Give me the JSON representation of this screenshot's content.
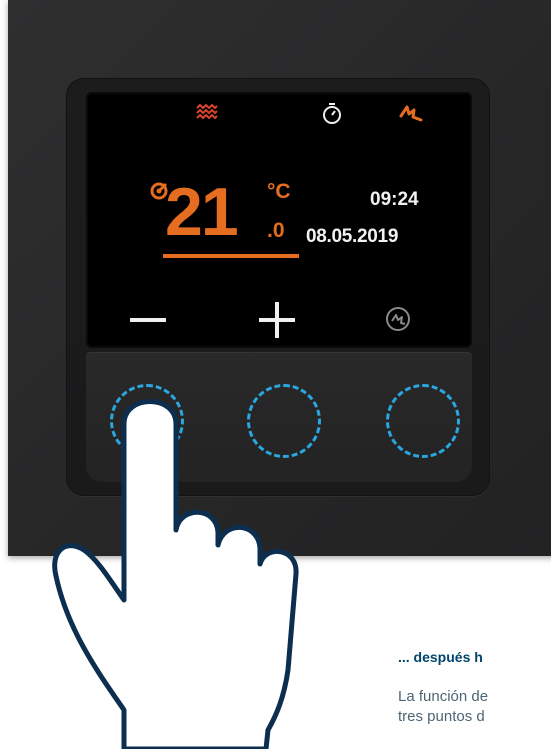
{
  "device": {
    "display": {
      "temperature_integer": "21",
      "temperature_unit": "°C",
      "temperature_decimal": ".0",
      "time": "09:24",
      "date": "08.05.2019"
    },
    "icons": [
      "heating-icon",
      "timer-icon",
      "boost-icon",
      "thermometer-arrow-icon",
      "eco-mode-icon"
    ],
    "buttons": [
      "minus-button",
      "plus-button",
      "mode-button"
    ],
    "colors": {
      "accent": "#e56d1f",
      "touch_ring": "#2aa7e0",
      "frame": "#2a2a2b",
      "screen": "#000000"
    }
  },
  "caption": {
    "title": "... después h",
    "body_line1": "La función de",
    "body_line2": "tres puntos d"
  }
}
